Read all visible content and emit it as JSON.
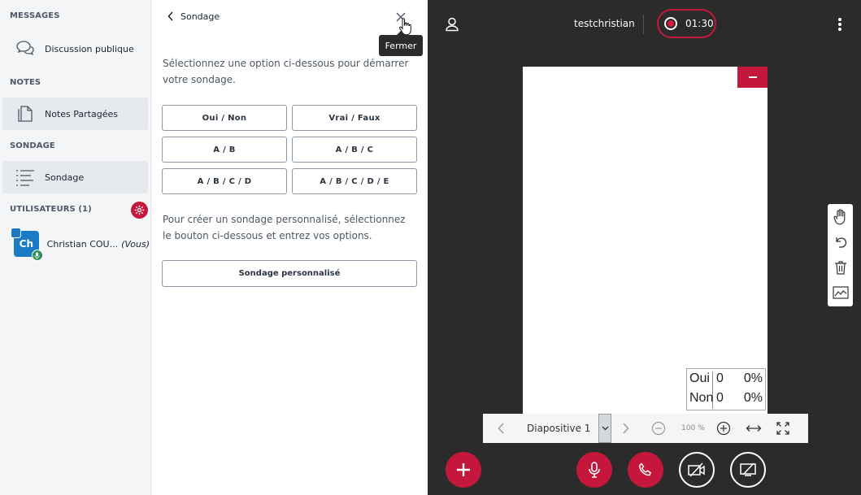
{
  "sidebar": {
    "messages_title": "MESSAGES",
    "public_chat": "Discussion publique",
    "notes_title": "NOTES",
    "shared_notes": "Notes Partagées",
    "poll_title": "SONDAGE",
    "poll_item": "Sondage",
    "users_title": "UTILISATEURS (1)",
    "user": {
      "initials": "Ch",
      "name": "Christian COU...",
      "you": "(Vous)"
    }
  },
  "poll": {
    "title": "Sondage",
    "close_tooltip": "Fermer",
    "intro": "Sélectionnez une option ci-dessous pour démarrer votre sondage.",
    "options": [
      "Oui / Non",
      "Vrai / Faux",
      "A / B",
      "A / B / C",
      "A / B / C / D",
      "A / B / C / D / E"
    ],
    "custom_intro": "Pour créer un sondage personnalisé, sélectionnez le bouton ci-dessous et entrez vos options.",
    "custom_button": "Sondage personnalisé"
  },
  "main": {
    "meeting_name": "testchristian",
    "record_time": "01:30",
    "results": [
      {
        "label": "Oui",
        "count": "0",
        "pct": "0%"
      },
      {
        "label": "Non",
        "count": "0",
        "pct": "0%"
      }
    ],
    "slide_label": "Diapositive 1",
    "zoom": "100 %"
  },
  "colors": {
    "accent": "#c5173c",
    "avatar": "#1a7ac4",
    "dark_bg": "#2b2b2b"
  }
}
